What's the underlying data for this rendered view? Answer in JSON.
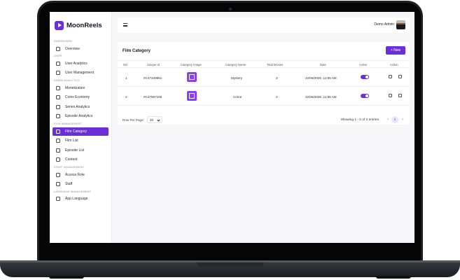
{
  "brand": {
    "name": "MoonReels"
  },
  "sidebar": {
    "sections": [
      {
        "title": "DASHBOARD",
        "items": [
          "Overview"
        ]
      },
      {
        "title": "USER",
        "items": [
          "User Analytics",
          "User Management"
        ]
      },
      {
        "title": "ADMIN ANALYTICS",
        "items": [
          "Monetization",
          "Coins Economy",
          "Series Analytics",
          "Episode Analytics"
        ]
      },
      {
        "title": "FILM MANAGEMENT",
        "items": [
          "Film Category",
          "Film List",
          "Episode List",
          "Content"
        ]
      },
      {
        "title": "STAFF MANAGEMENT",
        "items": [
          "Access Role",
          "Staff"
        ]
      },
      {
        "title": "LANGUAGE MANAGEMENT",
        "items": [
          "App Language"
        ]
      }
    ],
    "active": "Film Category"
  },
  "header": {
    "user_name": "Demo Admin"
  },
  "page": {
    "title": "Film Category",
    "new_button": "+ New"
  },
  "table": {
    "columns": [
      "NO",
      "Unique Id",
      "Category Image",
      "Category Name",
      "Total Movies",
      "Date",
      "Active",
      "Action"
    ],
    "rows": [
      {
        "no": "1",
        "id": "#C47349951",
        "name": "Mystery",
        "movies": "3",
        "date": "22/06/2026 ,11:55 AM",
        "active": true
      },
      {
        "no": "2",
        "id": "#C47597165",
        "name": "Crime",
        "movies": "2",
        "date": "22/06/2026 ,11:55 AM",
        "active": true
      }
    ]
  },
  "pagination": {
    "rows_label": "Row Per Page:",
    "rows_value": "20",
    "showing": "Showing 1 - 2 of 2 entries",
    "current": "1",
    "prev": "‹",
    "next": "›"
  },
  "colors": {
    "accent": "#6b2fd8"
  }
}
